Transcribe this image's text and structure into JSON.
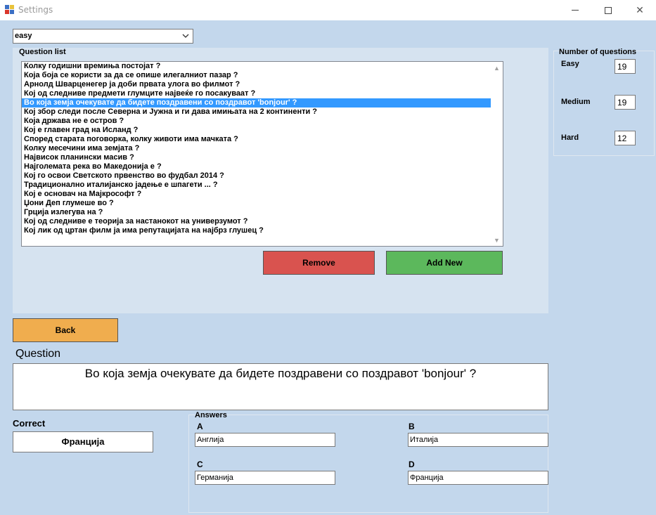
{
  "window": {
    "title": "Settings",
    "minimize_glyph": "",
    "maximize_glyph": "",
    "close_glyph": "✕"
  },
  "difficulty": {
    "selected": "easy",
    "arrow_icon": "chevron-down-icon"
  },
  "question_list": {
    "title": "Question list",
    "selected_index": 4,
    "items": [
      "Колку годишни времиња постојат ?",
      "Која боја се користи за да се опише илегалниот пазар ?",
      "Арнолд Шварценегер ја доби првата улога во филмот ?",
      "Кој од следниве предмети глумците највеќе го посакуваат ?",
      "Во која земја очекувате да бидете поздравени со поздравот 'bonjour' ?",
      "Кој збор следи после Северна и Јужна и ги дава имињата на 2 континенти ?",
      "Која држава не е остров ?",
      "Кој е главен град на Исланд ?",
      "Според старата поговорка, колку животи има мачката ?",
      "Колку месечини има земјата ?",
      "Највисок планински масив ?",
      "Најголемата река во Македонија е ?",
      "Кој го освои Светското првенство во фудбал 2014 ?",
      "Традиционално италијанско јадење е шпагети ... ?",
      "Кој е основач на Мајкрософт ?",
      "Џони Деп глумеше во ?",
      "Грција излегува на ?",
      "Кој од следниве е теорија за настанокот на универзумот ?",
      "Кој лик од цртан филм ја има репутацијата на најбрз глушец ?"
    ],
    "scroll_up": "▲",
    "scroll_down": "▼"
  },
  "buttons": {
    "remove": "Remove",
    "add_new": "Add New",
    "back": "Back"
  },
  "colors": {
    "remove": "#d9534f",
    "add_new": "#5cb85c",
    "back": "#f0ad4e",
    "selection": "#3399ff",
    "background": "#c3d7ec"
  },
  "number_of_questions": {
    "title": "Number of questions",
    "easy_label": "Easy",
    "easy_value": "19",
    "medium_label": "Medium",
    "medium_value": "19",
    "hard_label": "Hard",
    "hard_value": "12"
  },
  "question": {
    "heading": "Question",
    "text": "Во која земја очекувате да бидете поздравени со поздравот 'bonjour' ?"
  },
  "correct": {
    "heading": "Correct",
    "value": "Франција"
  },
  "answers": {
    "title": "Answers",
    "a_label": "A",
    "a_value": "Англија",
    "b_label": "B",
    "b_value": "Италија",
    "c_label": "C",
    "c_value": "Германија",
    "d_label": "D",
    "d_value": "Франција"
  }
}
